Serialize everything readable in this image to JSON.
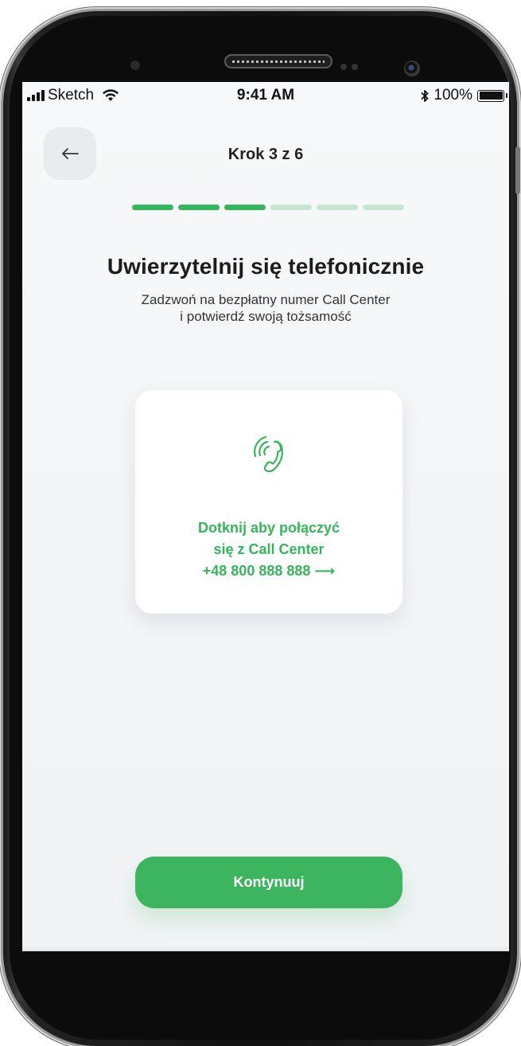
{
  "status_bar": {
    "carrier": "Sketch",
    "time": "9:41 AM",
    "battery_text": "100%",
    "icons": [
      "signal-icon",
      "wifi-icon",
      "bluetooth-icon",
      "battery-icon"
    ]
  },
  "header": {
    "back_icon": "arrow-left-icon",
    "step_label": "Krok 3 z 6"
  },
  "progress": {
    "total_steps": 6,
    "current_step": 3,
    "active_color": "#36b55a",
    "inactive_color": "#c6e6cf"
  },
  "content": {
    "heading": "Uwierzytelnij się telefonicznie",
    "subtitle_line1": "Zadzwoń na bezpłatny numer Call Center",
    "subtitle_line2": "i potwierdź swoją tożsamość"
  },
  "call_card": {
    "icon": "phone-call-icon",
    "line1": "Dotknij aby połączyć",
    "line2": "się z Call Center",
    "phone": "+48 800 888 888 ⟶"
  },
  "footer": {
    "continue_label": "Kontynuuj"
  },
  "colors": {
    "accent": "#36b55a",
    "button": "#3cb55e",
    "background": "#f3f5f7"
  }
}
